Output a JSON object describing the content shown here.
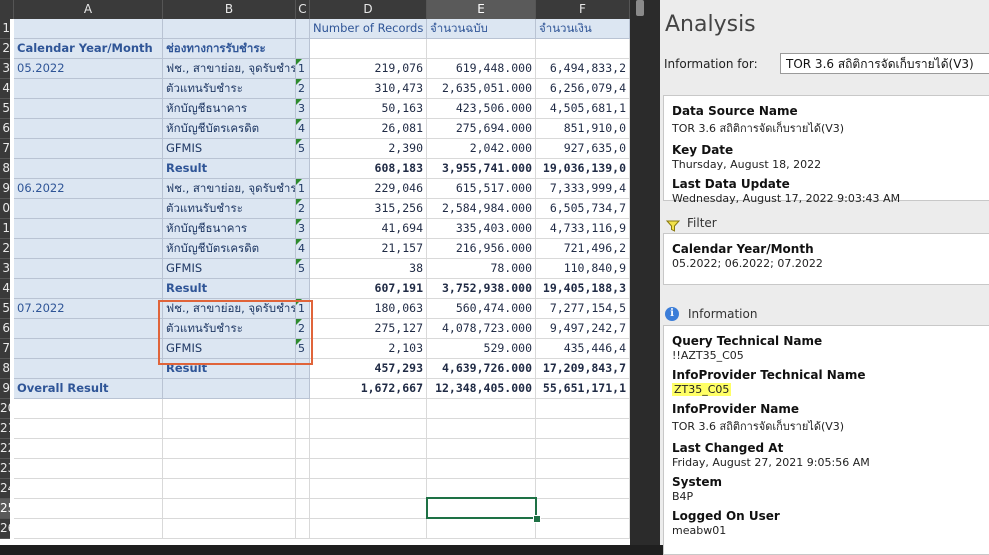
{
  "sheet": {
    "columns": [
      "A",
      "B",
      "C",
      "D",
      "E",
      "F"
    ],
    "rows": [
      "1",
      "2",
      "3",
      "4",
      "5",
      "6",
      "7",
      "8",
      "9",
      "0",
      "1",
      "2",
      "3",
      "4",
      "5",
      "6",
      "7",
      "8",
      "9",
      "20",
      "21",
      "22",
      "23",
      "24",
      "25",
      "26"
    ],
    "header": {
      "d": "Number of Records",
      "e": "จำนวนฉบับ",
      "f": "จำนวนเงิน",
      "a2": "Calendar Year/Month",
      "b2": "ช่องทางการรับชำระ"
    },
    "data": [
      {
        "a": "05.2022",
        "b": "ฟช., สาขาย่อย, จุดรับชำระ",
        "c": "1",
        "d": "219,076",
        "e": "619,448.000",
        "f": "6,494,833,2"
      },
      {
        "a": "",
        "b": "ตัวแทนรับชำระ",
        "c": "2",
        "d": "310,473",
        "e": "2,635,051.000",
        "f": "6,256,079,4"
      },
      {
        "a": "",
        "b": "หักบัญชีธนาคาร",
        "c": "3",
        "d": "50,163",
        "e": "423,506.000",
        "f": "4,505,681,1"
      },
      {
        "a": "",
        "b": "หักบัญชีบัตรเครดิต",
        "c": "4",
        "d": "26,081",
        "e": "275,694.000",
        "f": "851,910,0"
      },
      {
        "a": "",
        "b": "GFMIS",
        "c": "5",
        "d": "2,390",
        "e": "2,042.000",
        "f": "927,635,0"
      },
      {
        "a": "",
        "b": "Result",
        "c": "",
        "d": "608,183",
        "e": "3,955,741.000",
        "f": "19,036,139,0"
      },
      {
        "a": "06.2022",
        "b": "ฟช., สาขาย่อย, จุดรับชำระ",
        "c": "1",
        "d": "229,046",
        "e": "615,517.000",
        "f": "7,333,999,4"
      },
      {
        "a": "",
        "b": "ตัวแทนรับชำระ",
        "c": "2",
        "d": "315,256",
        "e": "2,584,984.000",
        "f": "6,505,734,7"
      },
      {
        "a": "",
        "b": "หักบัญชีธนาคาร",
        "c": "3",
        "d": "41,694",
        "e": "335,403.000",
        "f": "4,733,116,9"
      },
      {
        "a": "",
        "b": "หักบัญชีบัตรเครดิต",
        "c": "4",
        "d": "21,157",
        "e": "216,956.000",
        "f": "721,496,2"
      },
      {
        "a": "",
        "b": "GFMIS",
        "c": "5",
        "d": "38",
        "e": "78.000",
        "f": "110,840,9"
      },
      {
        "a": "",
        "b": "Result",
        "c": "",
        "d": "607,191",
        "e": "3,752,938.000",
        "f": "19,405,188,3"
      },
      {
        "a": "07.2022",
        "b": "ฟช., สาขาย่อย, จุดรับชำระ",
        "c": "1",
        "d": "180,063",
        "e": "560,474.000",
        "f": "7,277,154,5"
      },
      {
        "a": "",
        "b": "ตัวแทนรับชำระ",
        "c": "2",
        "d": "275,127",
        "e": "4,078,723.000",
        "f": "9,497,242,7"
      },
      {
        "a": "",
        "b": "GFMIS",
        "c": "5",
        "d": "2,103",
        "e": "529.000",
        "f": "435,446,4"
      },
      {
        "a": "",
        "b": "Result",
        "c": "",
        "d": "457,293",
        "e": "4,639,726.000",
        "f": "17,209,843,7"
      },
      {
        "a": "Overall Result",
        "b": "",
        "c": "",
        "d": "1,672,667",
        "e": "12,348,405.000",
        "f": "55,651,171,1"
      }
    ]
  },
  "analysis": {
    "title": "Analysis",
    "info_for_label": "Information for:",
    "info_for_value": "TOR 3.6 สถิติการจัดเก็บรายได้(V3)",
    "source": [
      {
        "label": "Data Source Name",
        "value": "TOR 3.6 สถิติการจัดเก็บรายได้(V3)"
      },
      {
        "label": "Key Date",
        "value": "Thursday, August 18, 2022"
      },
      {
        "label": "Last Data Update",
        "value": "Wednesday, August 17, 2022 9:03:43 AM"
      }
    ],
    "filter_title": "Filter",
    "filter": [
      {
        "label": "Calendar Year/Month",
        "value": "05.2022; 06.2022; 07.2022"
      }
    ],
    "info_title": "Information",
    "info": [
      {
        "label": "Query Technical Name",
        "value": "!!AZT35_C05"
      },
      {
        "label": "InfoProvider Technical Name",
        "value": "ZT35_C05"
      },
      {
        "label": "InfoProvider Name",
        "value": "TOR 3.6 สถิติการจัดเก็บรายได้(V3)"
      },
      {
        "label": "Last Changed At",
        "value": "Friday, August 27, 2021 9:05:56 AM"
      },
      {
        "label": "System",
        "value": "B4P"
      },
      {
        "label": "Logged On User",
        "value": "meabw01"
      }
    ]
  }
}
